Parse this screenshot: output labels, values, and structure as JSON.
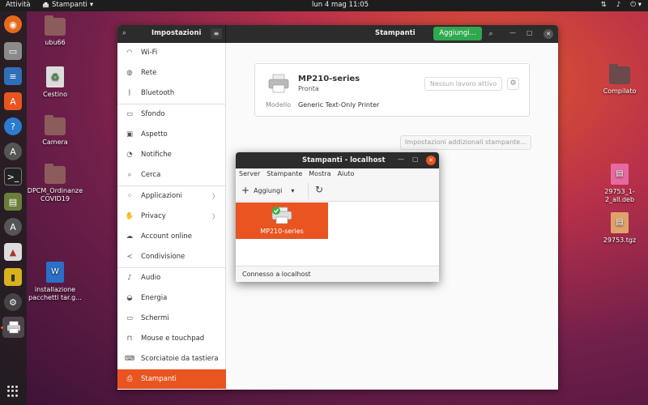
{
  "topbar": {
    "activities": "Attività",
    "app_menu": "Stampanti",
    "clock": "lun 4 mag  11:05"
  },
  "desktop": {
    "left_icons": [
      {
        "label": "ubu66"
      },
      {
        "label": "Cestino"
      },
      {
        "label": "Camera"
      },
      {
        "label": "DPCM_Ordinanze COVID19"
      },
      {
        "label": "installazione pacchetti tar.g..."
      }
    ],
    "right_icons": [
      {
        "label": "Compilato"
      },
      {
        "label": "29753_1-2_all.deb"
      },
      {
        "label": "29753.tgz"
      }
    ]
  },
  "settings": {
    "sidebar_title": "Impostazioni",
    "panel_title": "Stampanti",
    "add_button": "Aggiungi...",
    "sidebar_items": [
      {
        "label": "Wi-Fi"
      },
      {
        "label": "Rete"
      },
      {
        "label": "Bluetooth"
      },
      {
        "label": "Sfondo"
      },
      {
        "label": "Aspetto"
      },
      {
        "label": "Notifiche"
      },
      {
        "label": "Cerca"
      },
      {
        "label": "Applicazioni"
      },
      {
        "label": "Privacy"
      },
      {
        "label": "Account online"
      },
      {
        "label": "Condivisione"
      },
      {
        "label": "Audio"
      },
      {
        "label": "Energia"
      },
      {
        "label": "Schermi"
      },
      {
        "label": "Mouse e touchpad"
      },
      {
        "label": "Scorciatoie da tastiera"
      },
      {
        "label": "Stampanti"
      }
    ],
    "printer": {
      "name": "MP210-series",
      "status": "Pronta",
      "model_label": "Modello",
      "model_value": "Generic Text-Only Printer",
      "jobs_button": "Nessun lavoro attivo"
    },
    "additional_settings": "Impostazioni addizionali stampante…"
  },
  "printers_dialog": {
    "title": "Stampanti - localhost",
    "menu": [
      "Server",
      "Stampante",
      "Mostra",
      "Aiuto"
    ],
    "add_button": "Aggiungi",
    "printer_label": "MP210-series",
    "status": "Connesso a localhost"
  }
}
